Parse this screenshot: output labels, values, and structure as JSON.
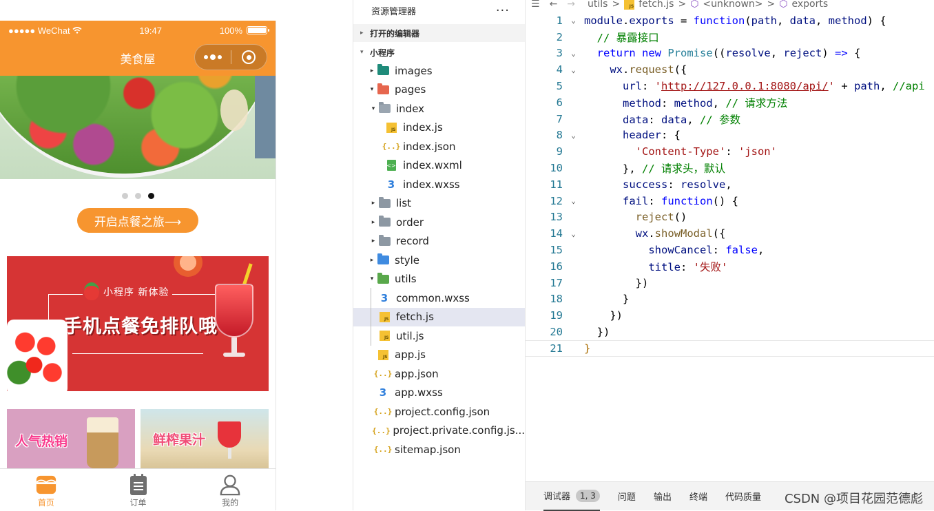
{
  "phone": {
    "status": {
      "carrier": "●●●●● WeChat",
      "time": "19:47",
      "battery": "100%",
      "battery_level": 1.0
    },
    "nav_title": "美食屋",
    "carousel": {
      "dot_count": 3,
      "active_dot": 2
    },
    "start_button": "开启点餐之旅⟶",
    "promo": {
      "sub": "小程序   新体验",
      "main": "手机点餐免排队哦"
    },
    "tiles": [
      {
        "label": "人气热销"
      },
      {
        "label": "鲜榨果汁"
      }
    ],
    "tabs": [
      {
        "label": "首页",
        "icon": "home-icon",
        "active": true
      },
      {
        "label": "订单",
        "icon": "order-icon",
        "active": false
      },
      {
        "label": "我的",
        "icon": "user-icon",
        "active": false
      }
    ]
  },
  "explorer": {
    "title": "资源管理器",
    "more": "···",
    "section_open_editors": "打开的编辑器",
    "section_project": "小程序",
    "tree": [
      {
        "label": "images",
        "icon": "folder-images-icon",
        "level": 1,
        "arrow": "▸"
      },
      {
        "label": "pages",
        "icon": "folder-pages-icon",
        "level": 1,
        "arrow": "▾"
      },
      {
        "label": "index",
        "icon": "folder-open-icon",
        "level": 2,
        "arrow": "▾"
      },
      {
        "label": "index.js",
        "icon": "js-file-icon",
        "level": 3,
        "arrow": ""
      },
      {
        "label": "index.json",
        "icon": "json-file-icon",
        "level": 3,
        "arrow": ""
      },
      {
        "label": "index.wxml",
        "icon": "wxml-file-icon",
        "level": 3,
        "arrow": ""
      },
      {
        "label": "index.wxss",
        "icon": "wxss-file-icon",
        "level": 3,
        "arrow": ""
      },
      {
        "label": "list",
        "icon": "folder-icon",
        "level": 2,
        "arrow": "▸"
      },
      {
        "label": "order",
        "icon": "folder-icon",
        "level": 2,
        "arrow": "▸"
      },
      {
        "label": "record",
        "icon": "folder-icon",
        "level": 2,
        "arrow": "▸"
      },
      {
        "label": "style",
        "icon": "folder-style-icon",
        "level": 1,
        "arrow": "▸"
      },
      {
        "label": "utils",
        "icon": "folder-utils-icon",
        "level": 1,
        "arrow": "▾"
      },
      {
        "label": "common.wxss",
        "icon": "wxss-file-icon",
        "level": 2,
        "arrow": ""
      },
      {
        "label": "fetch.js",
        "icon": "js-file-icon",
        "level": 2,
        "arrow": "",
        "selected": true
      },
      {
        "label": "util.js",
        "icon": "js-file-icon",
        "level": 2,
        "arrow": ""
      },
      {
        "label": "app.js",
        "icon": "js-file-icon",
        "level": 1,
        "arrow": ""
      },
      {
        "label": "app.json",
        "icon": "json-file-icon",
        "level": 1,
        "arrow": ""
      },
      {
        "label": "app.wxss",
        "icon": "wxss-file-icon",
        "level": 1,
        "arrow": ""
      },
      {
        "label": "project.config.json",
        "icon": "json-file-icon",
        "level": 1,
        "arrow": ""
      },
      {
        "label": "project.private.config.js...",
        "icon": "json-file-icon",
        "level": 1,
        "arrow": ""
      },
      {
        "label": "sitemap.json",
        "icon": "json-file-icon",
        "level": 1,
        "arrow": ""
      }
    ]
  },
  "editor": {
    "breadcrumbs": [
      "utils",
      ">",
      "fetch.js",
      ">",
      "<unknown>",
      ">",
      "exports"
    ],
    "lines": [
      {
        "n": "1",
        "fold": "⌄",
        "html": "<span class='v'>module</span>.<span class='v'>exports</span> = <span class='k'>function</span>(<span class='v'>path</span>, <span class='v'>data</span>, <span class='v'>method</span>) {"
      },
      {
        "n": "2",
        "fold": "",
        "html": "  <span class='c'>// 暴露接口</span>"
      },
      {
        "n": "3",
        "fold": "⌄",
        "html": "  <span class='k'>return</span> <span class='k'>new</span> <span class='t'>Promise</span>((<span class='v'>resolve</span>, <span class='v'>reject</span>) <span class='k'>=&gt;</span> {"
      },
      {
        "n": "4",
        "fold": "⌄",
        "html": "    <span class='v'>wx</span>.<span class='f'>request</span>({"
      },
      {
        "n": "5",
        "fold": "",
        "html": "      <span class='v'>url</span>: <span class='s'>'</span><span class='u'>http://127.0.0.1:8080/api/</span><span class='s'>'</span> + <span class='v'>path</span>, <span class='c'>//api</span>"
      },
      {
        "n": "6",
        "fold": "",
        "html": "      <span class='v'>method</span>: <span class='v'>method</span>, <span class='c'>// 请求方法</span>"
      },
      {
        "n": "7",
        "fold": "",
        "html": "      <span class='v'>data</span>: <span class='v'>data</span>, <span class='c'>// 参数</span>"
      },
      {
        "n": "8",
        "fold": "⌄",
        "html": "      <span class='v'>header</span>: {"
      },
      {
        "n": "9",
        "fold": "",
        "html": "        <span class='s'>'Content-Type'</span>: <span class='s'>'json'</span>"
      },
      {
        "n": "10",
        "fold": "",
        "html": "      }, <span class='c'>// 请求头，默认</span>"
      },
      {
        "n": "11",
        "fold": "",
        "html": "      <span class='v'>success</span>: <span class='v'>resolve</span>,"
      },
      {
        "n": "12",
        "fold": "⌄",
        "html": "      <span class='v'>fail</span>: <span class='k'>function</span>() {"
      },
      {
        "n": "13",
        "fold": "",
        "html": "        <span class='f'>reject</span>()"
      },
      {
        "n": "14",
        "fold": "⌄",
        "html": "        <span class='v'>wx</span>.<span class='f'>showModal</span>({"
      },
      {
        "n": "15",
        "fold": "",
        "html": "          <span class='v'>showCancel</span>: <span class='k'>false</span>,"
      },
      {
        "n": "16",
        "fold": "",
        "html": "          <span class='v'>title</span>: <span class='s'>'失败'</span>"
      },
      {
        "n": "17",
        "fold": "",
        "html": "        })"
      },
      {
        "n": "18",
        "fold": "",
        "html": "      }"
      },
      {
        "n": "19",
        "fold": "",
        "html": "    })"
      },
      {
        "n": "20",
        "fold": "",
        "html": "  })"
      },
      {
        "n": "21",
        "fold": "",
        "html": "<span class='p'>}</span>",
        "current": true
      }
    ]
  },
  "bottom_panel": {
    "tabs": [
      {
        "label": "调试器",
        "badge": "1, 3",
        "active": true
      },
      {
        "label": "问题",
        "badge": ""
      },
      {
        "label": "输出",
        "badge": ""
      },
      {
        "label": "终端",
        "badge": ""
      },
      {
        "label": "代码质量",
        "badge": ""
      }
    ],
    "watermark": "CSDN @项目花园范德彪"
  },
  "colors": {
    "accent": "#f7952f",
    "promo_red": "#d63434",
    "selection": "#e4e6f1"
  }
}
